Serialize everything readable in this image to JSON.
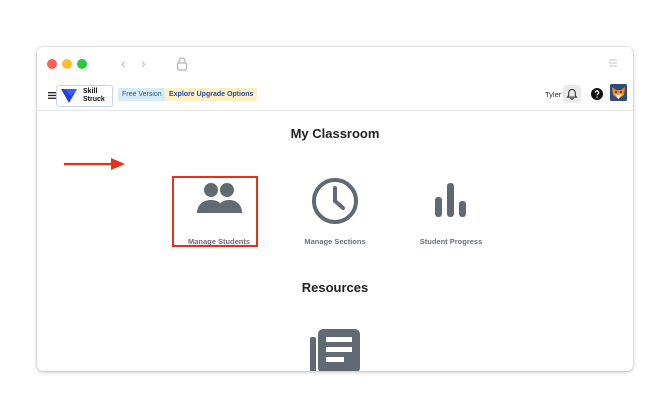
{
  "browser": {
    "nav_back": "‹",
    "nav_forward": "›"
  },
  "appbar": {
    "logo_line1": "Skill",
    "logo_line2": "Struck",
    "free_badge": "Free Version",
    "upgrade_link": "Explore Upgrade Options",
    "username": "Tyler"
  },
  "classroom": {
    "title": "My Classroom",
    "tiles": [
      {
        "label": "Manage Students",
        "icon": "people-icon"
      },
      {
        "label": "Manage Sections",
        "icon": "clock-icon"
      },
      {
        "label": "Student Progress",
        "icon": "bar-chart-icon"
      }
    ]
  },
  "resources": {
    "title": "Resources",
    "icon": "newspaper-icon"
  },
  "colors": {
    "icon_gray": "#616a72",
    "highlight_red": "#e4311a",
    "logo_blue": "#1f3fe0"
  }
}
